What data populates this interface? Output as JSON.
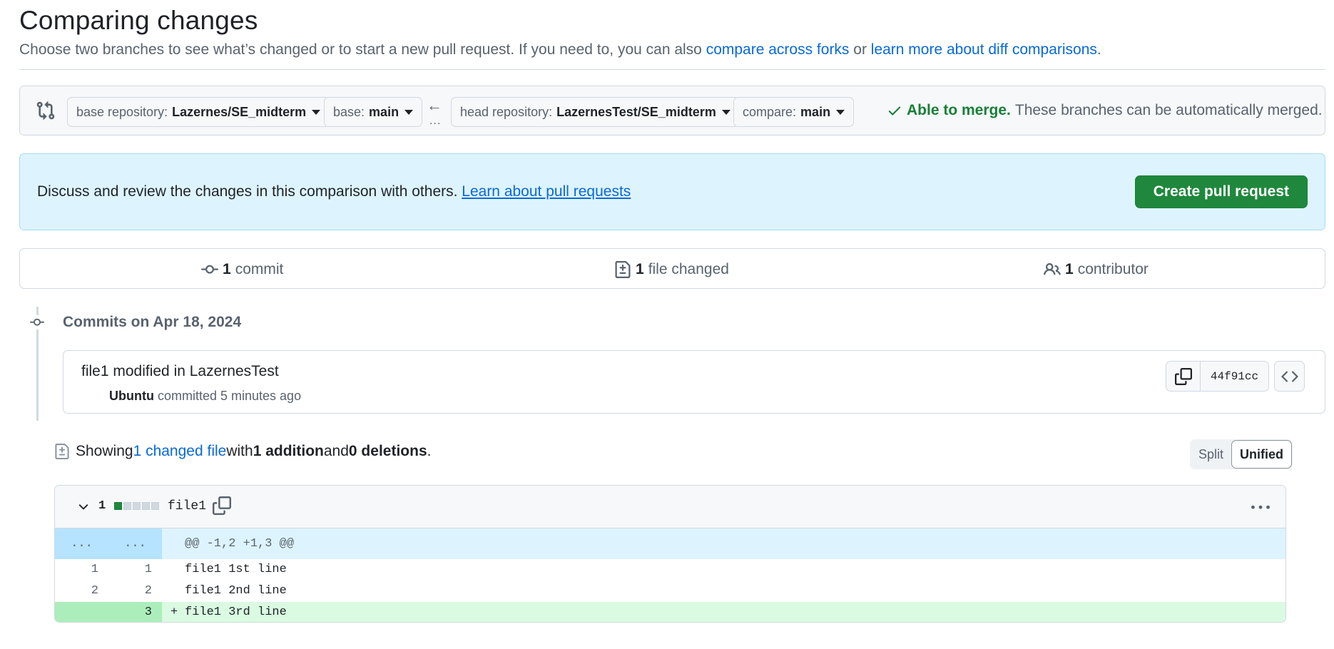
{
  "header": {
    "title": "Comparing changes",
    "subtitle_prefix": "Choose two branches to see what’s changed or to start a new pull request. If you need to, you can also ",
    "link_forks": "compare across forks",
    "subtitle_or": " or ",
    "link_diff": "learn more about diff comparisons",
    "subtitle_end": "."
  },
  "range": {
    "base_repo_label": "base repository:",
    "base_repo_value": "Lazernes/SE_midterm",
    "base_label": "base:",
    "base_value": "main",
    "head_repo_label": "head repository:",
    "head_repo_value": "LazernesTest/SE_midterm",
    "compare_label": "compare:",
    "compare_value": "main",
    "arrow": "←",
    "ellipsis": "...",
    "merge_ok": "Able to merge.",
    "merge_text": "These branches can be automatically merged."
  },
  "blankslate": {
    "message": "Discuss and review the changes in this comparison with others. ",
    "link": "Learn about pull requests",
    "button": "Create pull request"
  },
  "summary": {
    "commits_count": "1",
    "commits_label": "commit",
    "files_count": "1",
    "files_label": "file changed",
    "contributors_count": "1",
    "contributors_label": "contributor"
  },
  "commits": {
    "date_heading": "Commits on Apr 18, 2024",
    "items": [
      {
        "title": "file1 modified in LazernesTest",
        "author": "Ubuntu",
        "meta": " committed 5 minutes ago",
        "sha": "44f91cc"
      }
    ]
  },
  "toc": {
    "showing": "Showing ",
    "changed_files": "1 changed file",
    "with": " with ",
    "additions": "1 addition",
    "and": " and ",
    "deletions": "0 deletions",
    "end": ".",
    "split": "Split",
    "unified": "Unified"
  },
  "file": {
    "count": "1",
    "name": "file1",
    "diffstat": {
      "added": 1,
      "total": 5
    },
    "hunk": {
      "left": "...",
      "right": "...",
      "text": "@@ -1,2 +1,3 @@"
    },
    "lines": [
      {
        "old": "1",
        "new": "1",
        "marker": "",
        "text": "file1 1st line",
        "type": "context"
      },
      {
        "old": "2",
        "new": "2",
        "marker": "",
        "text": "file1 2nd line",
        "type": "context"
      },
      {
        "old": "",
        "new": "3",
        "marker": "+",
        "text": "file1 3rd line",
        "type": "added"
      }
    ]
  },
  "colors": {
    "accent": "#0969da",
    "success": "#1a7f37",
    "button_green": "#1f883d",
    "info_bg": "#ddf4ff",
    "added_bg": "#dafbe1"
  },
  "icons": {
    "compare": "git-compare-icon",
    "check": "check-icon",
    "commit": "git-commit-icon",
    "file_diff": "file-diff-icon",
    "people": "people-icon",
    "copy": "copy-icon",
    "code": "code-icon",
    "chevron": "chevron-down-icon",
    "kebab": "kebab-horizontal-icon"
  }
}
